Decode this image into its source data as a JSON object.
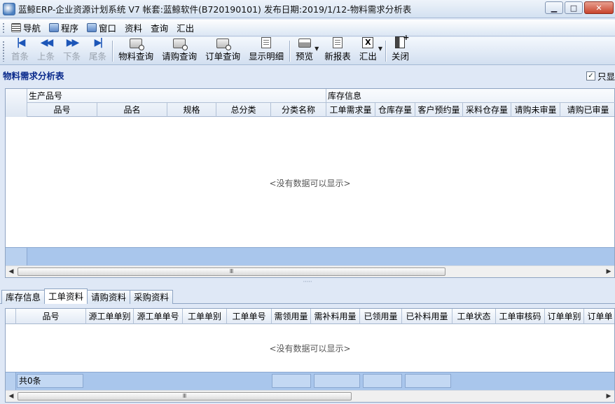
{
  "window": {
    "title": "蓝鲸ERP-企业资源计划系统 V7 帐套:蓝鲸软件(B720190101) 发布日期:2019/1/12-物料需求分析表",
    "minimize": "▁",
    "maximize": "□",
    "close": "✕"
  },
  "menu": {
    "items": [
      {
        "label": "导航",
        "icon": "navigation-icon"
      },
      {
        "label": "程序",
        "icon": "program-icon"
      },
      {
        "label": "窗口",
        "icon": "window-icon"
      },
      {
        "label": "资料"
      },
      {
        "label": "查询"
      },
      {
        "label": "汇出"
      }
    ]
  },
  "toolbar": {
    "first": "首条",
    "prev": "上条",
    "next": "下条",
    "last": "尾条",
    "material_query": "物料查询",
    "purchase_req_query": "请购查询",
    "order_query": "订单查询",
    "show_detail": "显示明细",
    "preview": "预览",
    "new_report": "新报表",
    "export": "汇出",
    "close": "关闭"
  },
  "panel": {
    "title": "物料需求分析表",
    "only_show_label": "只显",
    "only_show_checked": true
  },
  "upper_grid": {
    "groups": [
      "生产品号",
      "库存信息"
    ],
    "columns": [
      "品号",
      "品名",
      "规格",
      "总分类",
      "分类名称",
      "工单需求量",
      "仓库存量",
      "客户预约量",
      "采料仓存量",
      "请购未审量",
      "请购已审量"
    ],
    "empty_message": "<没有数据可以显示>"
  },
  "tabs": [
    "库存信息",
    "工单资料",
    "请购资料",
    "采购资料"
  ],
  "active_tab": 1,
  "lower_grid": {
    "columns": [
      "品号",
      "源工单单别",
      "源工单单号",
      "工单单别",
      "工单单号",
      "需领用量",
      "需补料用量",
      "已领用量",
      "已补料用量",
      "工单状态",
      "工单审核码",
      "订单单别",
      "订单单"
    ],
    "empty_message": "<没有数据可以显示>",
    "record_count": "共0条"
  },
  "scroll": {
    "left": "◀",
    "right": "▶",
    "grip": "Ⅲ"
  },
  "splitter_grip": "·····"
}
